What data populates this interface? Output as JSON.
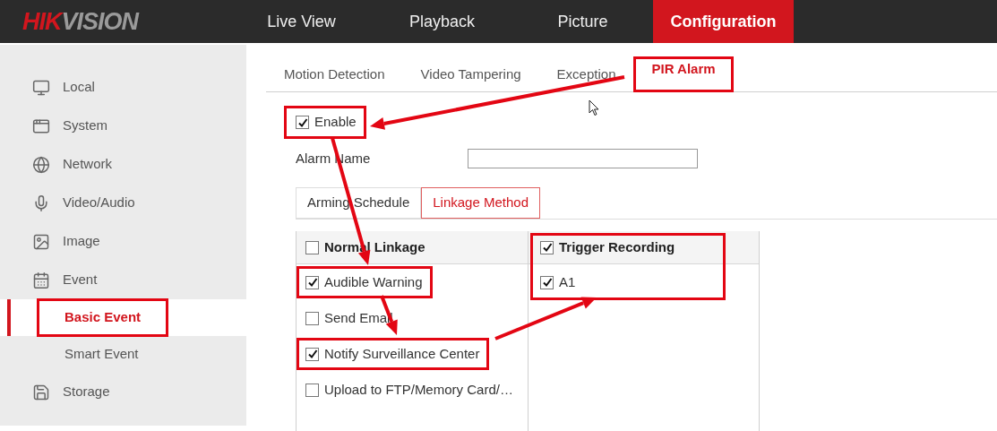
{
  "logo": {
    "accent": "HIK",
    "rest": "VISION"
  },
  "nav": [
    {
      "label": "Live View",
      "selected": false
    },
    {
      "label": "Playback",
      "selected": false
    },
    {
      "label": "Picture",
      "selected": false
    },
    {
      "label": "Configuration",
      "selected": true
    }
  ],
  "sidebar": {
    "items": [
      {
        "label": "Local",
        "selected": false
      },
      {
        "label": "System",
        "selected": false
      },
      {
        "label": "Network",
        "selected": false
      },
      {
        "label": "Video/Audio",
        "selected": false
      },
      {
        "label": "Image",
        "selected": false
      },
      {
        "label": "Event",
        "selected": false,
        "expanded": true,
        "children": [
          {
            "label": "Basic Event",
            "selected": true,
            "highlighted": true
          },
          {
            "label": "Smart Event",
            "selected": false,
            "highlighted": false
          }
        ]
      },
      {
        "label": "Storage",
        "selected": false
      }
    ]
  },
  "tabs": [
    {
      "label": "Motion Detection",
      "selected": false,
      "highlighted": false
    },
    {
      "label": "Video Tampering",
      "selected": false,
      "highlighted": false
    },
    {
      "label": "Exception",
      "selected": false,
      "highlighted": false
    },
    {
      "label": "PIR Alarm",
      "selected": true,
      "highlighted": true
    }
  ],
  "enable": {
    "label": "Enable",
    "checked": true,
    "highlighted": true
  },
  "alarm_name": {
    "label": "Alarm Name"
  },
  "sub_tabs": [
    {
      "label": "Arming Schedule",
      "selected": false
    },
    {
      "label": "Linkage Method",
      "selected": true
    }
  ],
  "linkage": {
    "normal": {
      "header": {
        "label": "Normal Linkage",
        "checked": false
      },
      "items": [
        {
          "label": "Audible Warning",
          "checked": true,
          "highlighted": true
        },
        {
          "label": "Send Email",
          "checked": false,
          "highlighted": false
        },
        {
          "label": "Notify Surveillance Center",
          "checked": true,
          "highlighted": true
        },
        {
          "label": "Upload to FTP/Memory Card/…",
          "checked": false,
          "highlighted": false
        }
      ]
    },
    "recording": {
      "highlighted": true,
      "header": {
        "label": "Trigger Recording",
        "checked": true
      },
      "items": [
        {
          "label": "A1",
          "checked": true
        }
      ]
    }
  }
}
